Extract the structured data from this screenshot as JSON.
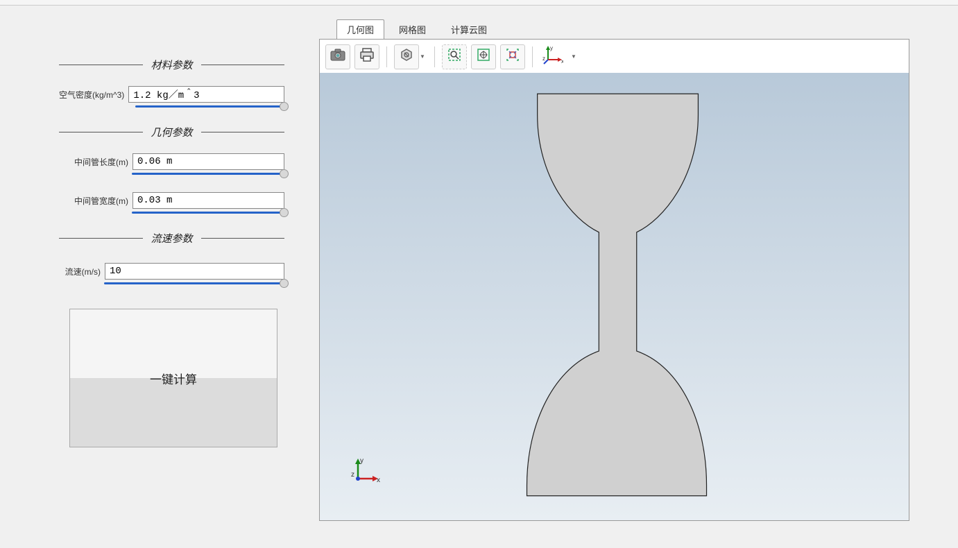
{
  "sections": {
    "material": {
      "title": "材料参数"
    },
    "geometry": {
      "title": "几何参数"
    },
    "flow": {
      "title": "流速参数"
    }
  },
  "params": {
    "air_density": {
      "label": "空气密度(kg/m^3)",
      "value": "1.2 kg／m＾3"
    },
    "tube_length": {
      "label": "中间管长度(m)",
      "value": "0.06 m"
    },
    "tube_width": {
      "label": "中间管宽度(m)",
      "value": "0.03 m"
    },
    "velocity": {
      "label": "流速(m/s)",
      "value": "10"
    }
  },
  "buttons": {
    "calculate": "一键计算"
  },
  "tabs": {
    "geometry": "几何图",
    "mesh": "网格图",
    "results": "计算云图"
  },
  "axis": {
    "x": "x",
    "y": "y",
    "z": "z"
  }
}
